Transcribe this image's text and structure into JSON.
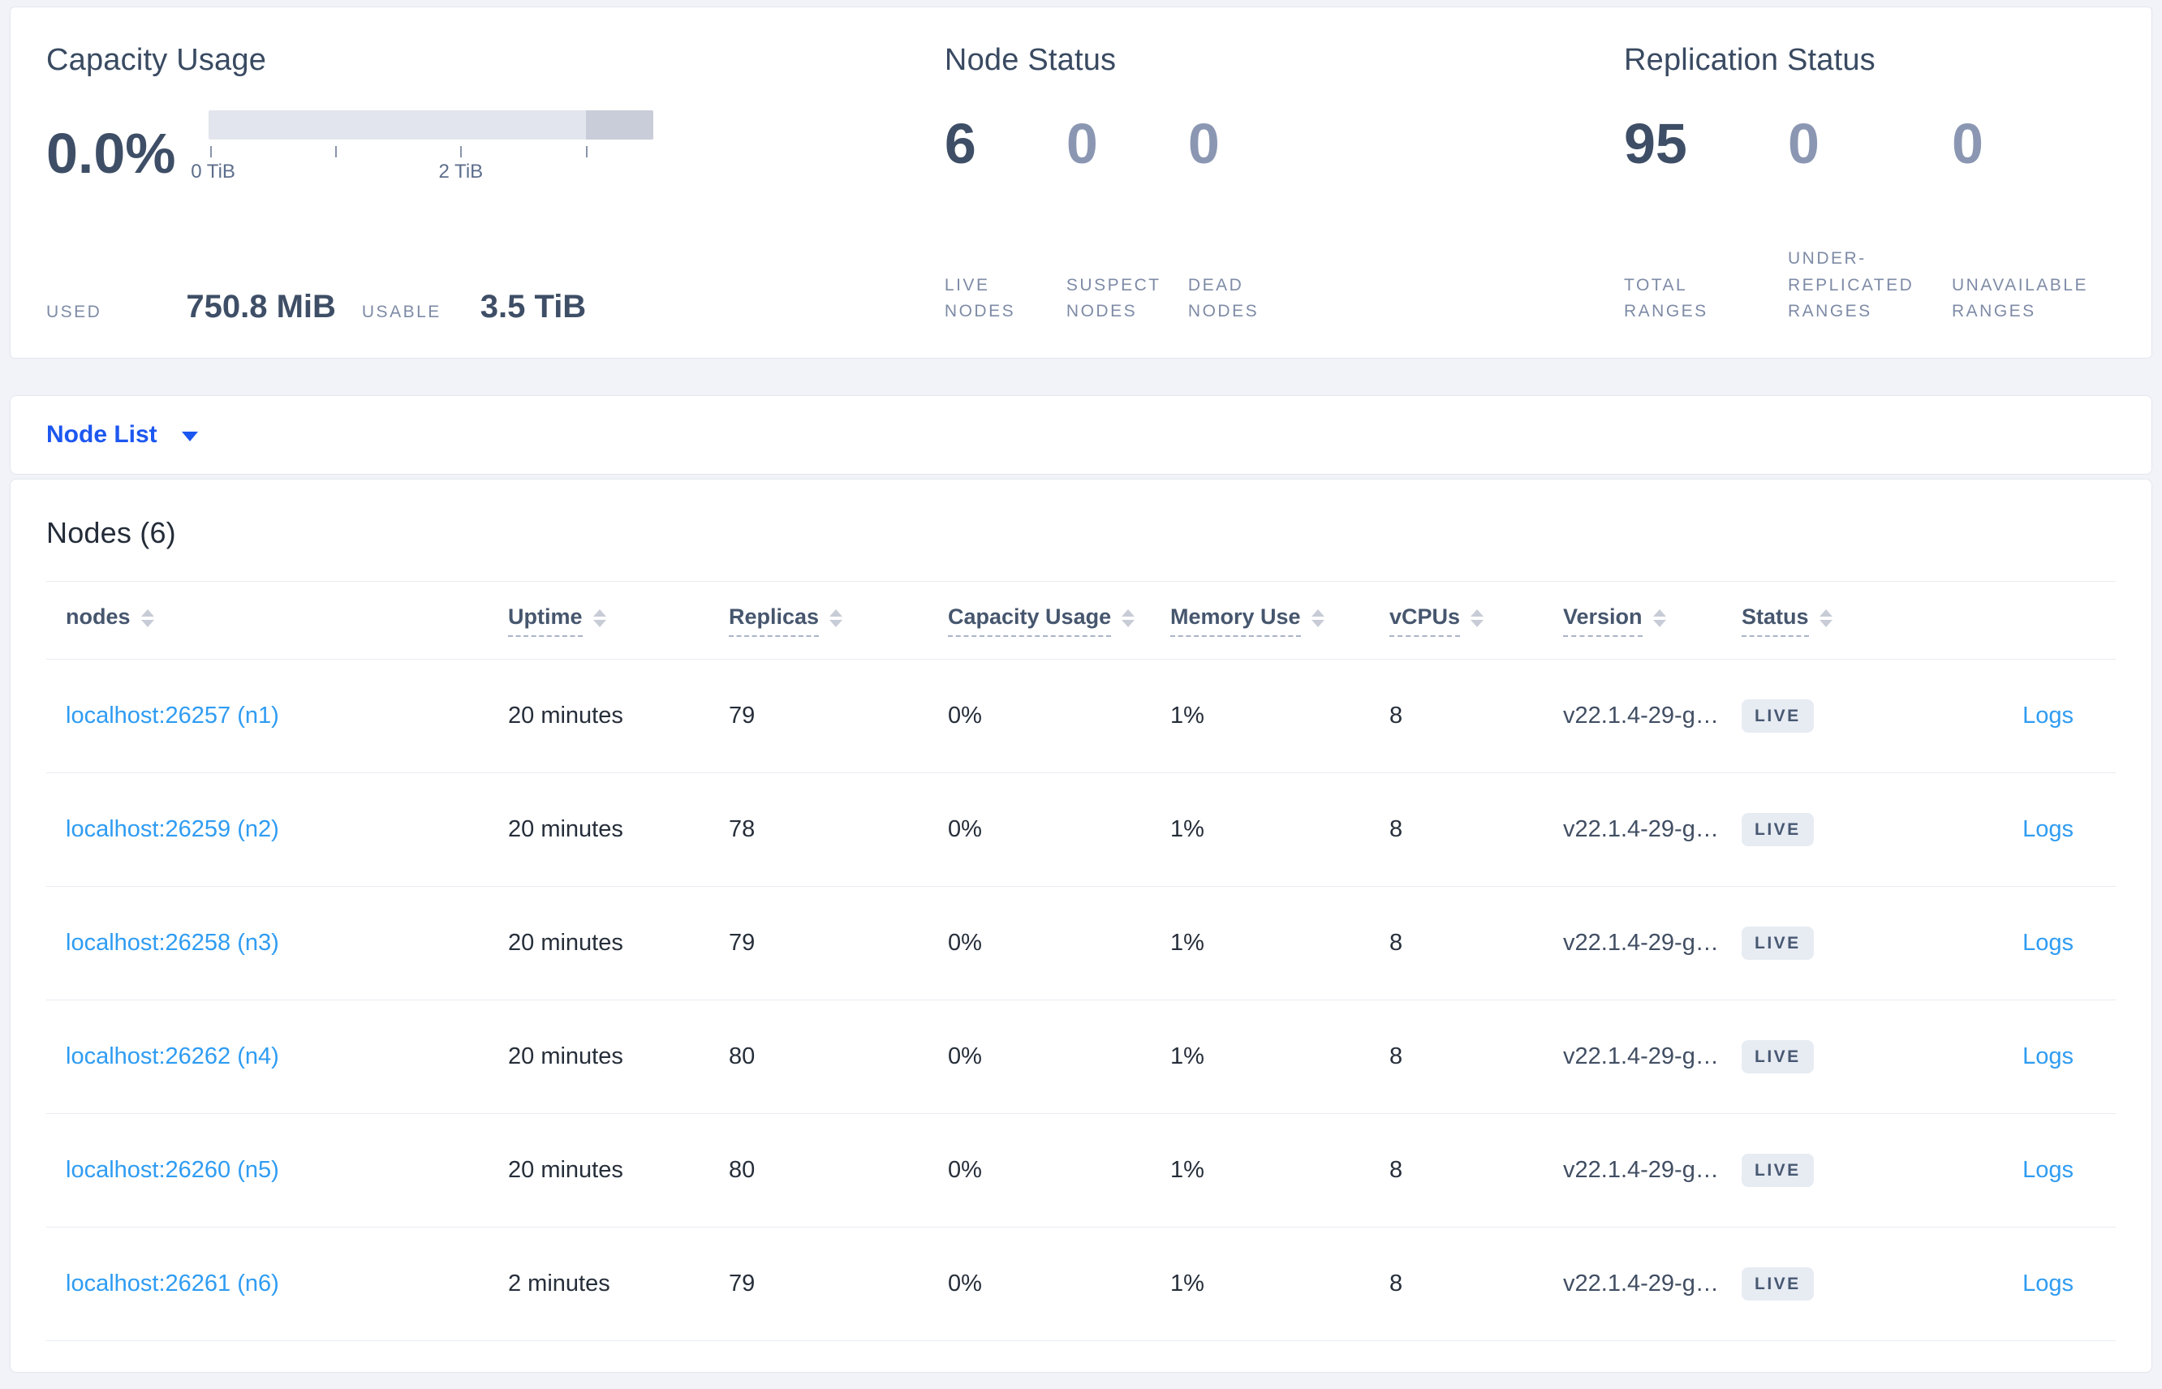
{
  "colors": {
    "page_bg": "#f1f3f8",
    "card_border": "#e3e6ee",
    "title": "#394a61",
    "value_dark": "#3e4e66",
    "value_muted": "#8b97b2",
    "label_muted": "#7e8ba6",
    "row_text": "#262e3a",
    "link_primary": "#1c57f0",
    "link_light": "#2f9cf2",
    "badge_bg": "#e7ebf2",
    "badge_text": "#475872",
    "bar_light": "#e2e5ed",
    "bar_dark": "#c9cdd9"
  },
  "summary": {
    "capacity": {
      "title": "Capacity Usage",
      "percent": "0.0%",
      "tick_labels": [
        "0 TiB",
        "2 TiB"
      ],
      "used_label": "USED",
      "used_value": "750.8 MiB",
      "usable_label": "USABLE",
      "usable_value": "3.5 TiB"
    },
    "node_status": {
      "title": "Node Status",
      "metrics": [
        {
          "value": "6",
          "label": "LIVE NODES"
        },
        {
          "value": "0",
          "label": "SUSPECT NODES"
        },
        {
          "value": "0",
          "label": "DEAD NODES"
        }
      ]
    },
    "replication": {
      "title": "Replication Status",
      "metrics": [
        {
          "value": "95",
          "label": "TOTAL RANGES"
        },
        {
          "value": "0",
          "label": "UNDER-REPLICATED RANGES"
        },
        {
          "value": "0",
          "label": "UNAVAILABLE RANGES"
        }
      ]
    }
  },
  "node_list": {
    "dropdown_label": "Node List"
  },
  "table": {
    "title": "Nodes (6)",
    "logs_label": "Logs",
    "columns": [
      {
        "label": "nodes"
      },
      {
        "label": "Uptime"
      },
      {
        "label": "Replicas"
      },
      {
        "label": "Capacity Usage"
      },
      {
        "label": "Memory Use"
      },
      {
        "label": "vCPUs"
      },
      {
        "label": "Version"
      },
      {
        "label": "Status"
      }
    ],
    "rows": [
      {
        "node": "localhost:26257 (n1)",
        "uptime": "20 minutes",
        "replicas": "79",
        "capacity": "0%",
        "memory": "1%",
        "vcpus": "8",
        "version": "v22.1.4-29-g…",
        "status": "LIVE"
      },
      {
        "node": "localhost:26259 (n2)",
        "uptime": "20 minutes",
        "replicas": "78",
        "capacity": "0%",
        "memory": "1%",
        "vcpus": "8",
        "version": "v22.1.4-29-g…",
        "status": "LIVE"
      },
      {
        "node": "localhost:26258 (n3)",
        "uptime": "20 minutes",
        "replicas": "79",
        "capacity": "0%",
        "memory": "1%",
        "vcpus": "8",
        "version": "v22.1.4-29-g…",
        "status": "LIVE"
      },
      {
        "node": "localhost:26262 (n4)",
        "uptime": "20 minutes",
        "replicas": "80",
        "capacity": "0%",
        "memory": "1%",
        "vcpus": "8",
        "version": "v22.1.4-29-g…",
        "status": "LIVE"
      },
      {
        "node": "localhost:26260 (n5)",
        "uptime": "20 minutes",
        "replicas": "80",
        "capacity": "0%",
        "memory": "1%",
        "vcpus": "8",
        "version": "v22.1.4-29-g…",
        "status": "LIVE"
      },
      {
        "node": "localhost:26261 (n6)",
        "uptime": "2 minutes",
        "replicas": "79",
        "capacity": "0%",
        "memory": "1%",
        "vcpus": "8",
        "version": "v22.1.4-29-g…",
        "status": "LIVE"
      }
    ]
  }
}
